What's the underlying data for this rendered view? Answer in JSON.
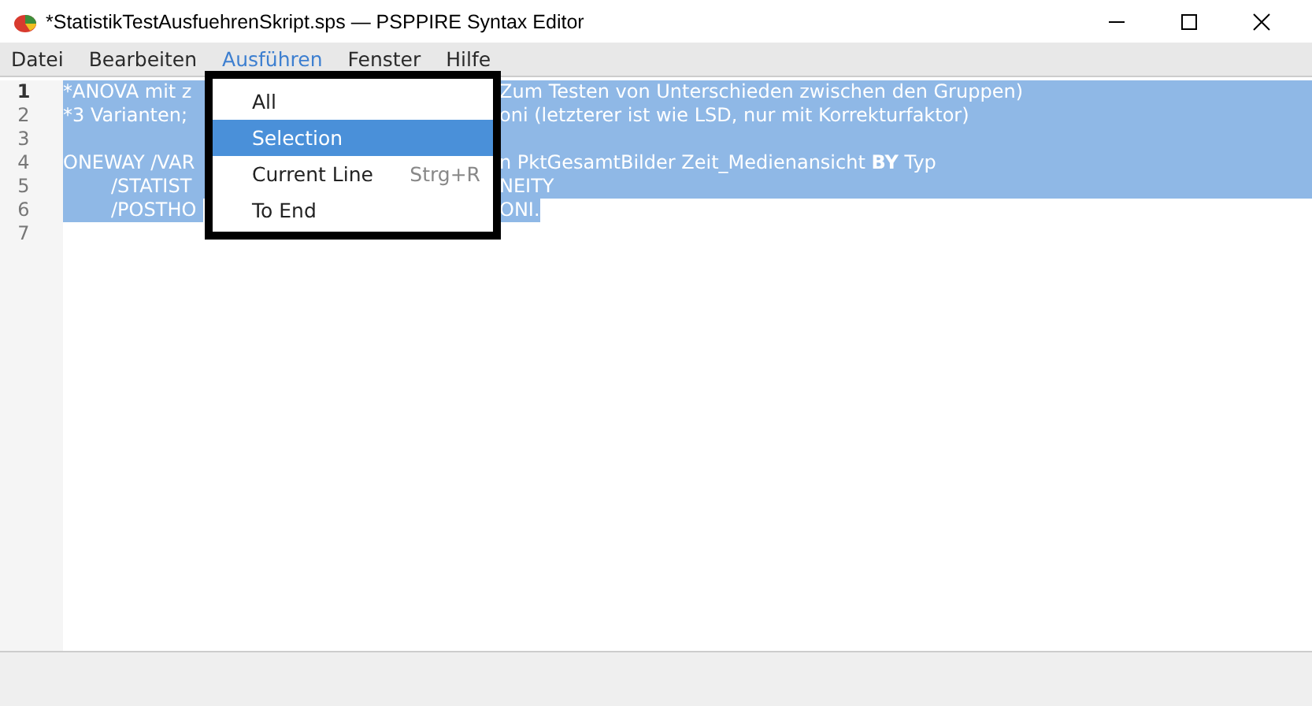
{
  "window": {
    "title": "*StatistikTestAusfuehrenSkript.sps — PSPPIRE Syntax Editor"
  },
  "menu_bar": [
    {
      "label": "Datei",
      "selected": false
    },
    {
      "label": "Bearbeiten",
      "selected": false
    },
    {
      "label": "Ausführen",
      "selected": true
    },
    {
      "label": "Fenster",
      "selected": false
    },
    {
      "label": "Hilfe",
      "selected": false
    }
  ],
  "editor": {
    "lines": [
      {
        "number": "1",
        "current": true,
        "selected": true,
        "left": "*ANOVA mit z",
        "right": "Zum Testen von Unterschieden zwischen den Gruppen)"
      },
      {
        "number": "2",
        "current": false,
        "selected": true,
        "left": "*3 Varianten;",
        "right": "oni (letzterer ist wie LSD, nur mit Korrekturfaktor)"
      },
      {
        "number": "3",
        "current": false,
        "selected": true
      },
      {
        "number": "4",
        "current": false,
        "selected": true,
        "left": "ONEWAY /VAR",
        "right": "n PktGesamtBilder Zeit_Medienansicht **BY** Typ"
      },
      {
        "number": "5",
        "current": false,
        "selected": true,
        "left": "        /STATIST",
        "right": "NEITY"
      },
      {
        "number": "6",
        "current": false,
        "selected": true,
        "partial": true,
        "left": "        /POSTHO",
        "right": "ONI."
      },
      {
        "number": "7",
        "current": false,
        "selected": false
      }
    ]
  },
  "dropdown": {
    "items": [
      {
        "label": "All",
        "selected": false
      },
      {
        "label": "Selection",
        "selected": true
      },
      {
        "label": "Current Line",
        "selected": false,
        "shortcut": "Strg+R"
      },
      {
        "label": "To End",
        "selected": false
      }
    ]
  }
}
